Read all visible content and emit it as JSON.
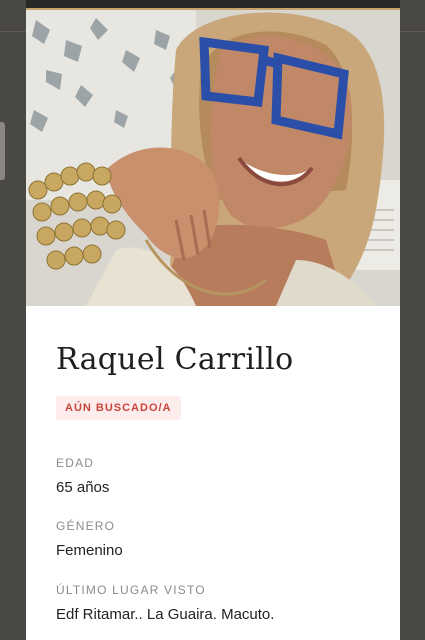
{
  "profile": {
    "name": "Raquel Carrillo",
    "status_badge": "AÚN BUSCADO/A",
    "fields": [
      {
        "label": "EDAD",
        "value": "65 años"
      },
      {
        "label": "GÉNERO",
        "value": "Femenino"
      },
      {
        "label": "ÚLTIMO LUGAR VISTO",
        "value": "Edf Ritamar.. La Guaira. Macuto."
      }
    ]
  },
  "colors": {
    "badge_text": "#c9463d",
    "badge_bg": "#fdecec",
    "page_bg": "#4a4845",
    "card_bg": "#ffffff"
  }
}
